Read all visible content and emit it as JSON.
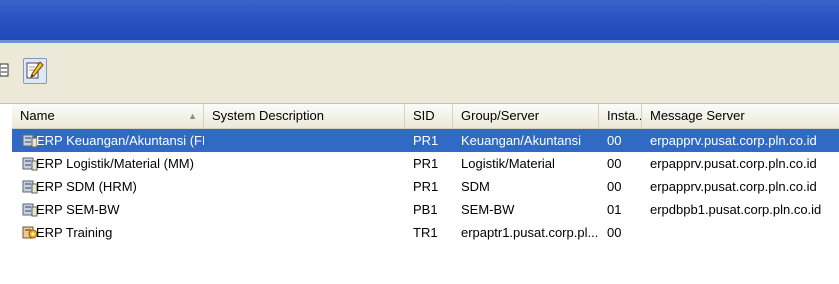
{
  "columns": {
    "name": "Name",
    "description": "System Description",
    "sid": "SID",
    "group": "Group/Server",
    "instance": "Insta...",
    "message_server": "Message Server"
  },
  "sort_indicator": "▲",
  "rows": [
    {
      "name": "ERP Keuangan/Akuntansi (FM)",
      "description": "",
      "sid": "PR1",
      "group": "Keuangan/Akuntansi",
      "instance": "00",
      "message_server": "erpapprv.pusat.corp.pln.co.id",
      "icon": "sap-system-icon",
      "selected": true
    },
    {
      "name": "ERP Logistik/Material (MM)",
      "description": "",
      "sid": "PR1",
      "group": "Logistik/Material",
      "instance": "00",
      "message_server": "erpapprv.pusat.corp.pln.co.id",
      "icon": "sap-system-icon",
      "selected": false
    },
    {
      "name": "ERP SDM (HRM)",
      "description": "",
      "sid": "PR1",
      "group": "SDM",
      "instance": "00",
      "message_server": "erpapprv.pusat.corp.pln.co.id",
      "icon": "sap-system-icon",
      "selected": false
    },
    {
      "name": "ERP SEM-BW",
      "description": "",
      "sid": "PB1",
      "group": "SEM-BW",
      "instance": "01",
      "message_server": "erpdbpb1.pusat.corp.pln.co.id",
      "icon": "sap-system-icon",
      "selected": false
    },
    {
      "name": "ERP Training",
      "description": "",
      "sid": "TR1",
      "group": "erpaptr1.pusat.corp.pl...",
      "instance": "00",
      "message_server": "",
      "icon": "sap-system-custom-icon",
      "selected": false
    }
  ],
  "colors": {
    "titlebar": "#2a54c2",
    "selection": "#316ac5",
    "toolbar": "#ece9d8"
  }
}
